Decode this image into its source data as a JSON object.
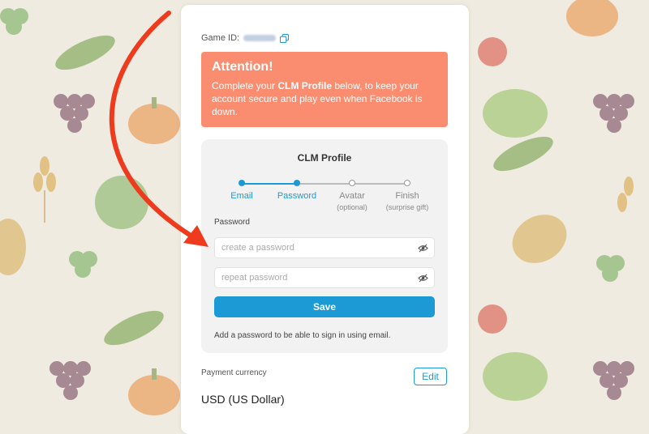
{
  "game_id": {
    "label": "Game ID:",
    "value_hidden": true,
    "copy_icon": "copy-icon"
  },
  "attention": {
    "title": "Attention!",
    "body_prefix": "Complete your ",
    "body_bold": "CLM Profile",
    "body_suffix": " below, to keep your account secure and play even when Facebook is down.",
    "color": "#fa8c6f"
  },
  "profile": {
    "title": "CLM Profile",
    "steps": [
      {
        "label": "Email",
        "sub": "",
        "active": true
      },
      {
        "label": "Password",
        "sub": "",
        "active": true
      },
      {
        "label": "Avatar",
        "sub": "(optional)",
        "active": false
      },
      {
        "label": "Finish",
        "sub": "(surprise gift)",
        "active": false
      }
    ],
    "password_label": "Password",
    "password_placeholder": "create a password",
    "repeat_placeholder": "repeat password",
    "eye_icon": "eye-off-icon",
    "save_label": "Save",
    "hint": "Add a password to be able to sign in using email.",
    "accent": "#1c9ad6"
  },
  "payment": {
    "label": "Payment currency",
    "edit_label": "Edit",
    "currency": "USD (US Dollar)"
  },
  "annotation": {
    "arrow_color": "#ee3b1d"
  }
}
